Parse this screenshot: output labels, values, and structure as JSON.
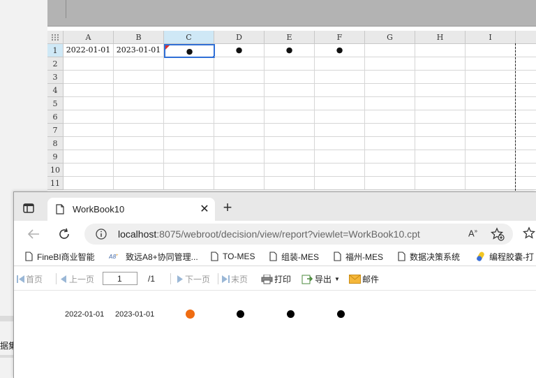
{
  "spreadsheet": {
    "left_panel_label": "据集",
    "columns": [
      "A",
      "B",
      "C",
      "D",
      "E",
      "F",
      "G",
      "H",
      "I"
    ],
    "rows": [
      "1",
      "2",
      "3",
      "4",
      "5",
      "6",
      "7",
      "8",
      "9",
      "10",
      "11"
    ],
    "selected_column": "C",
    "selected_row": "1",
    "active_cell": "C1",
    "row1_values": {
      "A": "2022-01-01",
      "B": "2023-01-01",
      "C": "●",
      "D": "●",
      "E": "●",
      "F": "●"
    }
  },
  "browser": {
    "tab_title": "WorkBook10",
    "url_host": "localhost",
    "url_rest": ":8075/webroot/decision/view/report?viewlet=WorkBook10.cpt",
    "read_aloud": "A",
    "bookmarks": [
      "FineBI商业智能",
      "致远A8+协同管理...",
      "TO-MES",
      "组装-MES",
      "福州-MES",
      "数据决策系统",
      "编程胶囊-打"
    ],
    "toolbar": {
      "first": "首页",
      "prev": "上一页",
      "page_value": "1",
      "page_total": "/1",
      "next": "下一页",
      "last": "末页",
      "print": "打印",
      "export": "导出",
      "email": "邮件"
    },
    "report": {
      "date_a": "2022-01-01",
      "date_b": "2023-01-01",
      "highlight_color": "#ef6c12"
    }
  }
}
